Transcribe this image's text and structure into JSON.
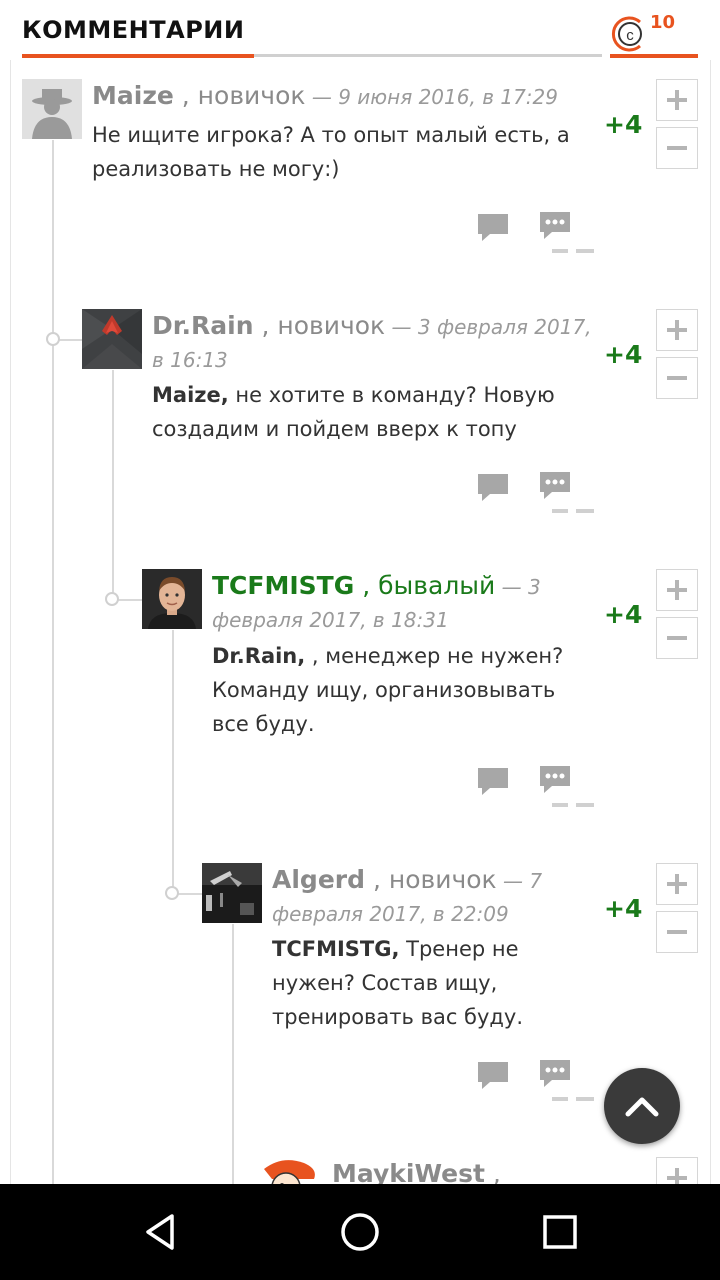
{
  "header": {
    "title": "КОММЕНТАРИИ",
    "comment_count": "10",
    "logo_icon": "site-logo-c",
    "accent": "#e8531f"
  },
  "comments": [
    {
      "author": "Maize",
      "separator": " ,",
      "rank": " новичок",
      "date": " — 9 июня 2016, в 17:29",
      "body": "Не ищите игрока? А то опыт малый есть, а реализовать не могу:)",
      "rating": "+4"
    },
    {
      "author": "Dr.Rain",
      "separator": " ,",
      "rank": " новичок",
      "date": " — 3 февраля 2017, в 16:13",
      "mention": "Maize,",
      "body": "  не хотите в команду? Новую создадим и пойдем вверх к топу",
      "rating": "+4"
    },
    {
      "author": "TCFMISTG",
      "separator": " ,",
      "rank": " бывалый",
      "date": " — 3 февраля 2017, в 18:31",
      "mention": "Dr.Rain,",
      "body": " , менеджер не нужен? Команду ищу, организовывать все буду.",
      "rating": "+4"
    },
    {
      "author": "Algerd",
      "separator": " ,",
      "rank": " новичок",
      "date": " — 7 февраля 2017, в 22:09",
      "mention": "TCFMISTG,",
      "body": "  Тренер не нужен? Состав ищу, тренировать вас буду.",
      "rating": "+4"
    },
    {
      "author": "MaykiWest",
      "separator": " ,"
    }
  ],
  "actions": {
    "vote_up": "+",
    "vote_down": "−"
  },
  "colors": {
    "positive": "#1a7a1a",
    "muted": "#8a8a8a",
    "accent": "#e8531f"
  }
}
